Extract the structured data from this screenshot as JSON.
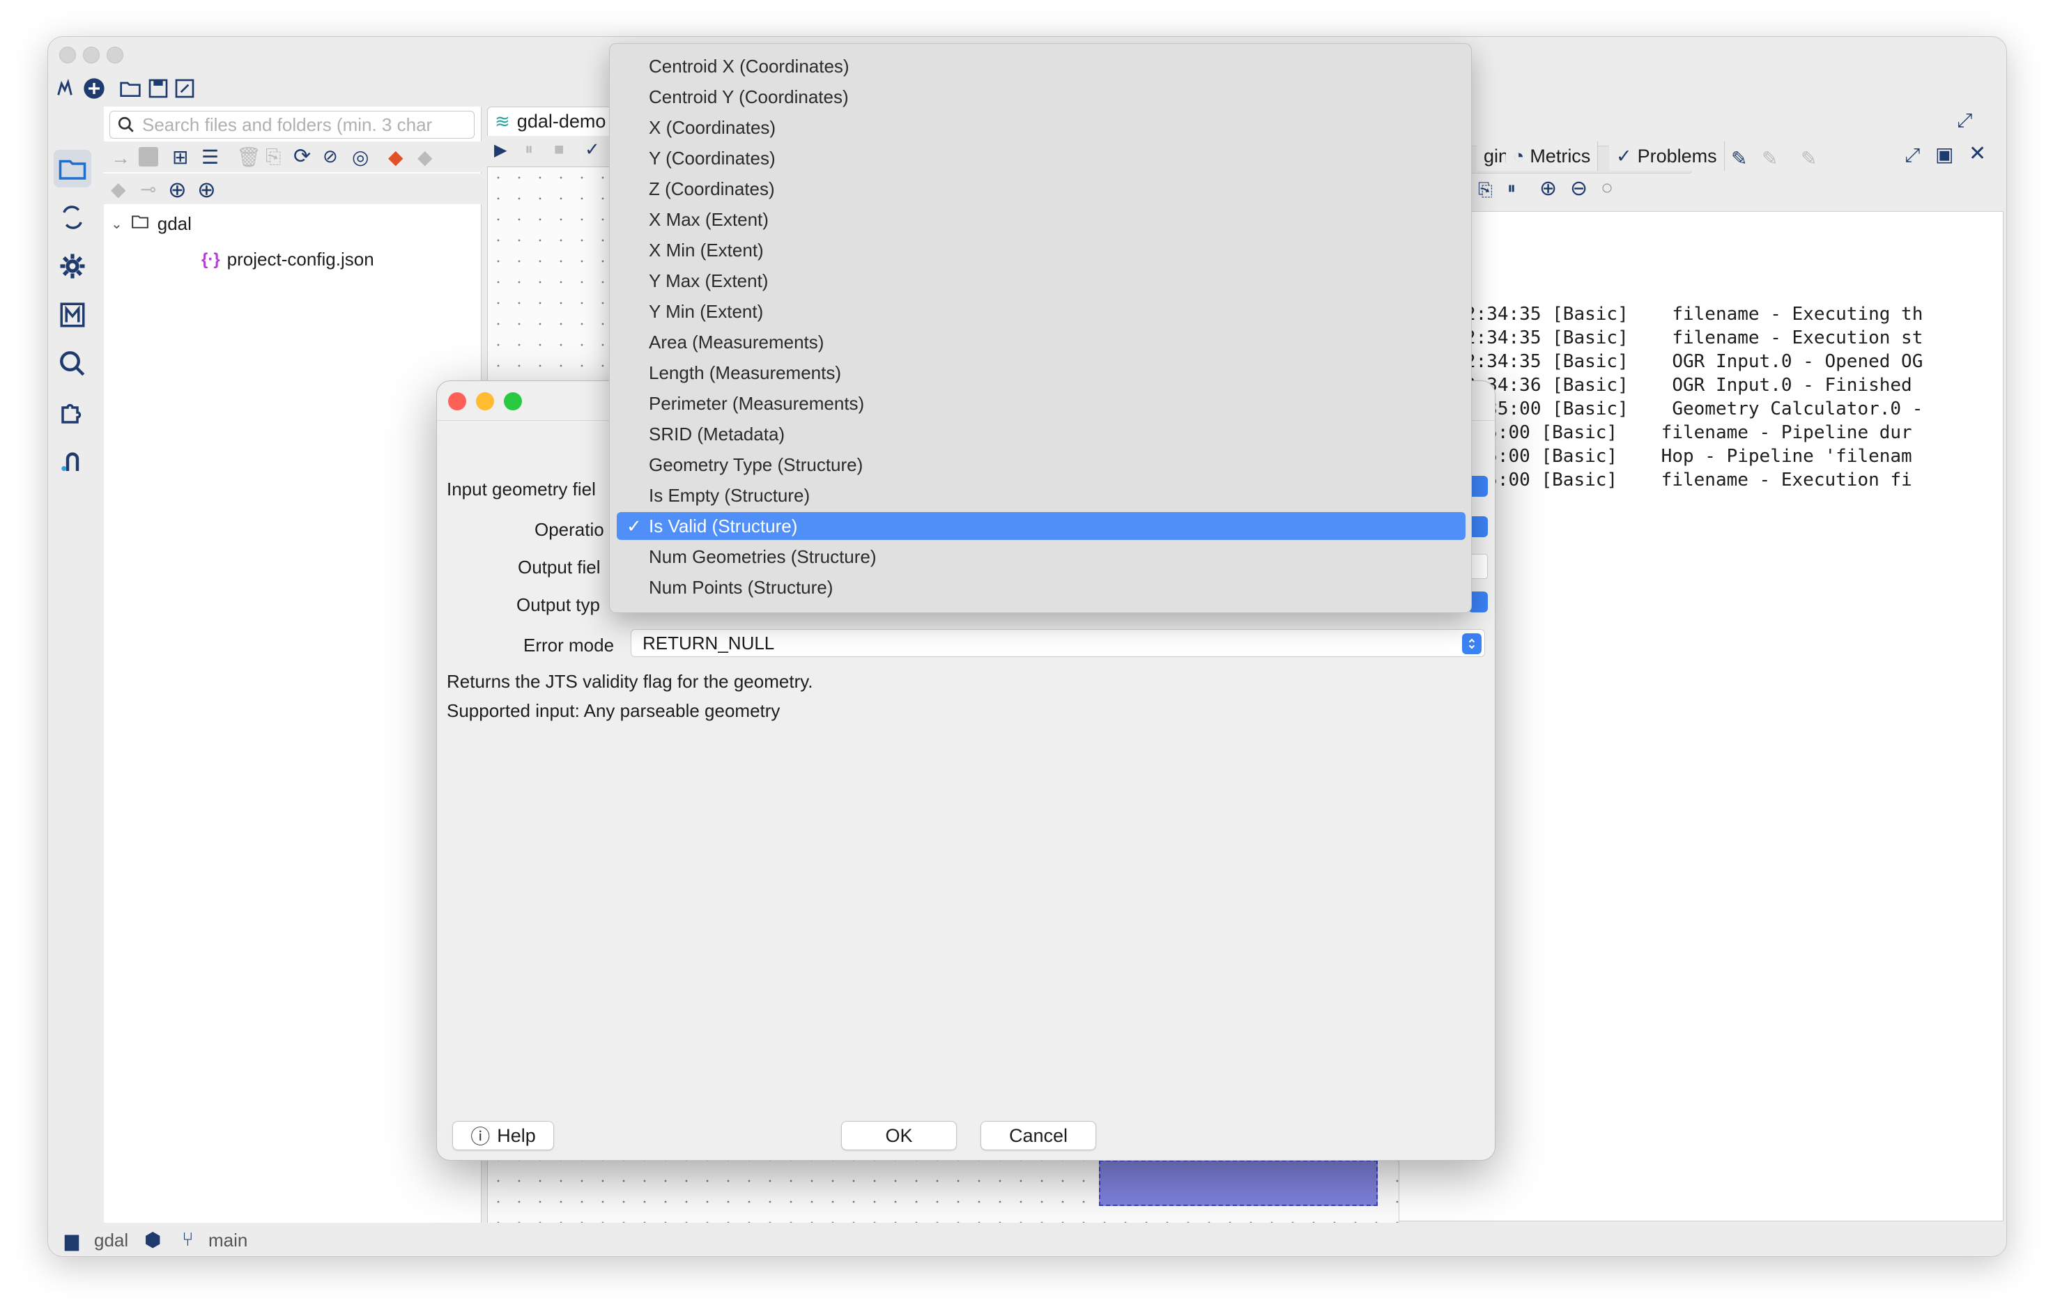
{
  "explorer": {
    "search_placeholder": "Search files and folders (min. 3 char",
    "tree": [
      {
        "label": "gdal"
      },
      {
        "label": "project-config.json"
      }
    ]
  },
  "center": {
    "tab_label": "gdal-demo"
  },
  "right_panel": {
    "tabs": [
      {
        "label": "ging"
      },
      {
        "label": "Metrics"
      },
      {
        "label": "Problems"
      }
    ],
    "log_lines": [
      "5/11 12:34:35 [Basic]    filename - Executing th",
      "5/11 12:34:35 [Basic]    filename - Execution st",
      "5/11 12:34:35 [Basic]    OGR Input.0 - Opened OG",
      "5/11 12:34:36 [Basic]    OGR Input.0 - Finished ",
      "5/11 12:35:00 [Basic]    Geometry Calculator.0 -",
      " 11 12:35:00 [Basic]    filename - Pipeline dur",
      " 11 12:35:00 [Basic]    Hop - Pipeline 'filenam",
      " 11 12:35:00 [Basic]    filename - Execution fi"
    ]
  },
  "status_bar": {
    "project": "gdal",
    "branch": "main"
  },
  "dialog": {
    "labels": {
      "input_geometry_field": "Input geometry fiel",
      "operation": "Operatio",
      "output_field": "Output fiel",
      "output_type": "Output typ",
      "error_mode": "Error mode"
    },
    "error_mode_value": "RETURN_NULL",
    "description_lines": [
      "Returns the JTS validity flag for the geometry.",
      "Supported input: Any parseable geometry"
    ],
    "buttons": {
      "help": "Help",
      "ok": "OK",
      "cancel": "Cancel"
    }
  },
  "dropdown": {
    "items": [
      {
        "label": "Centroid X (Coordinates)",
        "selected": false
      },
      {
        "label": "Centroid Y (Coordinates)",
        "selected": false
      },
      {
        "label": "X (Coordinates)",
        "selected": false
      },
      {
        "label": "Y (Coordinates)",
        "selected": false
      },
      {
        "label": "Z (Coordinates)",
        "selected": false
      },
      {
        "label": "X Max (Extent)",
        "selected": false
      },
      {
        "label": "X Min (Extent)",
        "selected": false
      },
      {
        "label": "Y Max (Extent)",
        "selected": false
      },
      {
        "label": "Y Min (Extent)",
        "selected": false
      },
      {
        "label": "Area (Measurements)",
        "selected": false
      },
      {
        "label": "Length (Measurements)",
        "selected": false
      },
      {
        "label": "Perimeter (Measurements)",
        "selected": false
      },
      {
        "label": "SRID (Metadata)",
        "selected": false
      },
      {
        "label": "Geometry Type (Structure)",
        "selected": false
      },
      {
        "label": "Is Empty (Structure)",
        "selected": false
      },
      {
        "label": "Is Valid (Structure)",
        "selected": true
      },
      {
        "label": "Num Geometries (Structure)",
        "selected": false
      },
      {
        "label": "Num Points (Structure)",
        "selected": false
      }
    ],
    "check_glyph": "✓"
  },
  "colors": {
    "accent": "#4f8ff7",
    "selection": "#7f82dd",
    "close": "#fe5f57",
    "minimize": "#febc2e",
    "zoom": "#28c840"
  }
}
